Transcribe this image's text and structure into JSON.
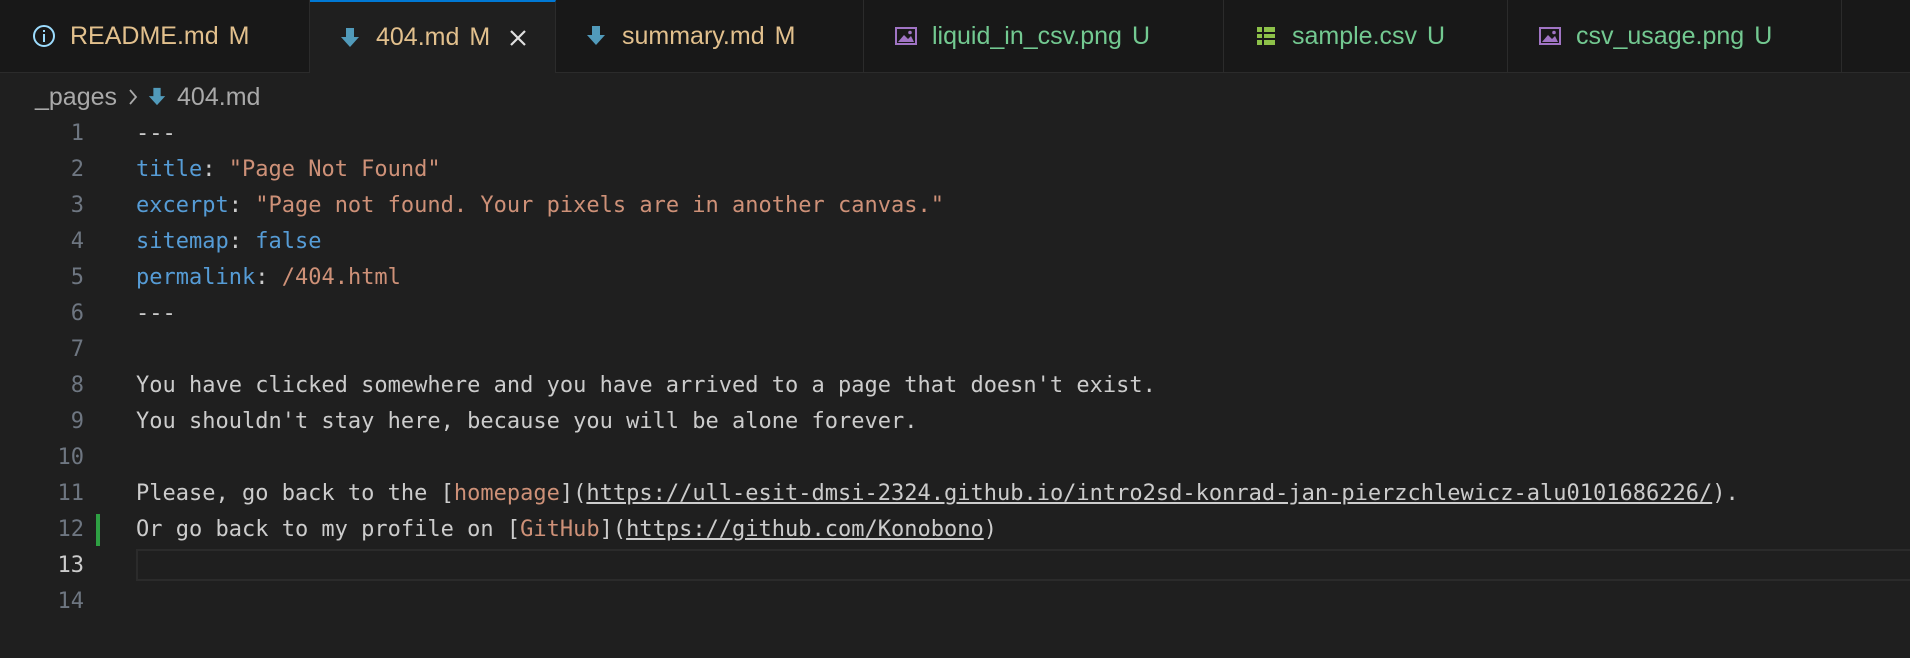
{
  "tabs": [
    {
      "label": "README.md",
      "badge": "M",
      "icon": "info-icon",
      "color": "#e2c08d",
      "badge_color": "#e2c08d",
      "active": false
    },
    {
      "label": "404.md",
      "badge": "M",
      "icon": "markdown-download-icon",
      "color": "#e2c08d",
      "badge_color": "#e2c08d",
      "active": true
    },
    {
      "label": "summary.md",
      "badge": "M",
      "icon": "markdown-download-icon",
      "color": "#e2c08d",
      "badge_color": "#e2c08d",
      "active": false
    },
    {
      "label": "liquid_in_csv.png",
      "badge": "U",
      "icon": "image-icon",
      "color": "#73c991",
      "badge_color": "#73c991",
      "active": false
    },
    {
      "label": "sample.csv",
      "badge": "U",
      "icon": "table-icon",
      "color": "#73c991",
      "badge_color": "#73c991",
      "active": false
    },
    {
      "label": "csv_usage.png",
      "badge": "U",
      "icon": "image-icon",
      "color": "#73c991",
      "badge_color": "#73c991",
      "active": false
    }
  ],
  "breadcrumb": {
    "folder": "_pages",
    "file": "404.md"
  },
  "editor": {
    "current_line": 13,
    "modified_line": 12,
    "lines": [
      {
        "num": "1",
        "text": "---"
      },
      {
        "num": "2",
        "key": "title",
        "colon": ": ",
        "value": "\"Page Not Found\""
      },
      {
        "num": "3",
        "key": "excerpt",
        "colon": ": ",
        "value": "\"Page not found. Your pixels are in another canvas.\""
      },
      {
        "num": "4",
        "key": "sitemap",
        "colon": ": ",
        "value": "false"
      },
      {
        "num": "5",
        "key": "permalink",
        "colon": ": ",
        "value": "/404.html"
      },
      {
        "num": "6",
        "text": "---"
      },
      {
        "num": "7",
        "text": ""
      },
      {
        "num": "8",
        "text": "You have clicked somewhere and you have arrived to a page that doesn't exist."
      },
      {
        "num": "9",
        "text": "You shouldn't stay here, because you will be alone forever."
      },
      {
        "num": "10",
        "text": ""
      },
      {
        "num": "11",
        "prefix": "Please, go back to the [",
        "link": "homepage",
        "mid": "](",
        "url": "https://ull-esit-dmsi-2324.github.io/intro2sd-konrad-jan-pierzchlewicz-alu0101686226/",
        "suffix": ")."
      },
      {
        "num": "12",
        "prefix": "Or go back to my profile on [",
        "link": "GitHub",
        "mid": "](",
        "url": "https://github.com/Konobono",
        "suffix": ")"
      },
      {
        "num": "13",
        "text": ""
      },
      {
        "num": "14",
        "text": ""
      }
    ]
  },
  "colors": {
    "background": "#1f1f1f",
    "tabbar": "#181818",
    "modified": "#e2c08d",
    "untracked": "#73c991",
    "yaml_key": "#569cd6",
    "string": "#ce9178",
    "gutter_added": "#2ea043"
  }
}
